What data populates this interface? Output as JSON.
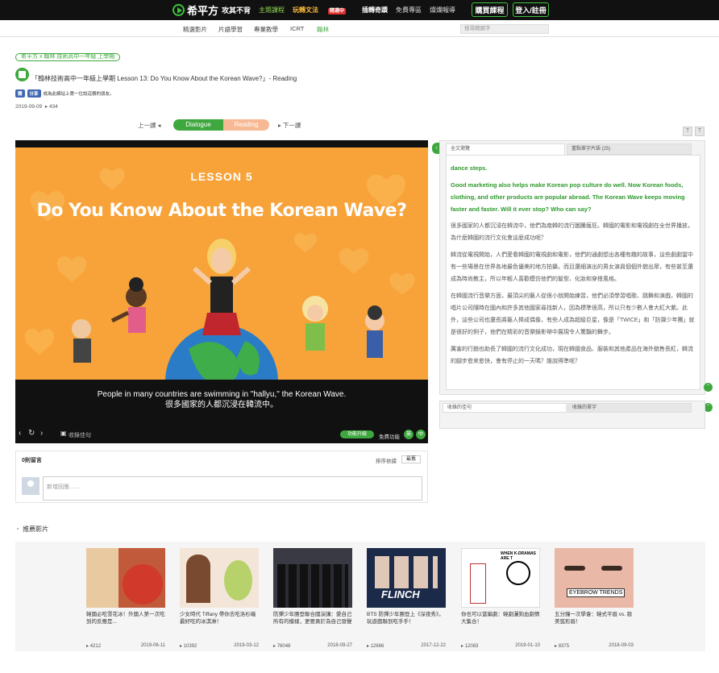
{
  "topbar": {
    "logo": "希平方",
    "nav": {
      "brand": "攻其不背",
      "theme": "主題課程",
      "wonder": "玩轉文法",
      "wonder_badge": "精選中",
      "special": "插轉奇蹟",
      "free": "免費專區",
      "news": "燦爛報導"
    },
    "buy_label": "購買課程",
    "login_label": "登入/註冊"
  },
  "subnav": {
    "items": [
      "精選影片",
      "片語學習",
      "專業教學",
      "ICRT",
      "翰林"
    ],
    "search_placeholder": "搜尋關鍵字"
  },
  "breadcrumb": "希平方 x 翰林 技術高中一年級 上學期",
  "course_title": "「翰林技術高中一年級上學期 Lesson 13: Do You Know About the Korean Wave?」- Reading",
  "social": {
    "like": "讚",
    "share": "分享",
    "text": "成為此網站上第一位說這讚的朋友。"
  },
  "meta": {
    "date": "2019-09-09",
    "views": "434"
  },
  "pager": {
    "prev": "上一課",
    "next": "下一課",
    "tab_dialogue": "Dialogue",
    "tab_reading": "Reading"
  },
  "video": {
    "lesson_label": "LESSON 5",
    "headline": "Do You Know About the Korean Wave?",
    "subtitle_en": "People in many countries are swimming in \"hallyu,\" the Korean Wave.",
    "subtitle_zh": "很多國家的人都沉浸在韓流中。",
    "mark_label": "收錄佳句",
    "func_label": "功能升級",
    "free_label": "免費功能",
    "lang_en": "英",
    "lang_zh": "中"
  },
  "transcript": {
    "tab_full": "全文瀏覽",
    "tab_vocab": "重點單字片語 (25)",
    "paragraphs": [
      {
        "type": "eng",
        "text": "dance steps."
      },
      {
        "type": "eng",
        "text": "Good marketing also helps make Korean pop culture do well. Now Korean foods, clothing, and other products are popular abroad. The Korean Wave keeps moving faster and faster. Will it ever stop? Who can say?"
      },
      {
        "type": "zh",
        "text": "很多國家的人都沉浸在韓流中，他們為南韓的流行圖騰瘋狂。韓國的電影和電視劇在全世界播放，為什麼韓國的流行文化會這麼成功呢？"
      },
      {
        "type": "zh",
        "text": "韓流從電視開始，人們愛看韓國的電視劇和電影，他們的通劇想出各種有趣的故事，這些劇劇當中有一些場景在世界各地最色優美的地方拍攝，而且還細演出的男女演員個個外貌出眾，有些甚至還成為時尚教主，所以年輕人喜歡模仿他們的髮型、化妝和穿搭風格。"
      },
      {
        "type": "zh",
        "text": "在韓國流行音樂方面，最頂尖的藝人從很小就開始練習，他們必須學習唱歌、跳舞和演戲，韓國的唱片公司隨時在國內和許多其他國家尋找新人，因為標準很高，所以只有少數人會大紅大紫。此外，這些公司也還長將藝人捧成偶像，有些人成為超級巨星，像是「TWICE」和「防彈少年團」就是很好的例子，他們在精彩的音樂錄影帶中展現令人驚豔的舞步。"
      },
      {
        "type": "zh",
        "text": "厲害的行銷也助長了韓國的流行文化成功，現在韓國食品、服裝和其他產品在海外銷售長紅，韓流的腳步愈來愈快，會有停止的一天嗎？誰說得準呢？"
      }
    ]
  },
  "notes": {
    "tab_sentences": "收錄的佳句",
    "tab_words": "收錄的單字"
  },
  "comments": {
    "count_label": "0則留言",
    "sort_label": "排序依據",
    "sort_value": "最舊",
    "reply_placeholder": "新增回應……"
  },
  "recommend": {
    "title": "推薦影片",
    "cards": [
      {
        "title": "韓國必吃雪花冰！外國人第一次吃到的反應是...",
        "views": "4212",
        "date": "2019-06-11"
      },
      {
        "title": "少女時代 Tiffany 帶你去吃洛杉磯最好吃的冰淇淋！",
        "views": "10392",
        "date": "2019-03-12"
      },
      {
        "title": "防彈少年團登聯合國演講：愛自己所有的模樣，更要勇於為自己發聲",
        "views": "76048",
        "date": "2018-09-27"
      },
      {
        "title": "BTS 防彈少年團登上《深夜秀》，玩遊戲聯到吃手手！",
        "views": "12666",
        "date": "2017-12-22"
      },
      {
        "title": "你也可以當編劇：韓劇灑狗血劇情大集合！",
        "views": "12083",
        "date": "2019-01-10"
      },
      {
        "title": "五分鐘一次學會：韓式平眉 vs. 歐美弧形眉！",
        "views": "8375",
        "date": "2018-09-03"
      }
    ],
    "thumb_texts": {
      "flinch": "FLINCH",
      "when": "WHEN K-DRAMAS ARE T",
      "eyebrow": "EYEBROW TRENDS"
    }
  }
}
